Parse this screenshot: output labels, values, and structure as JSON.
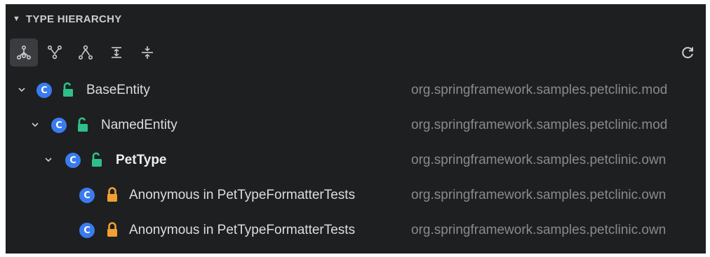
{
  "panel": {
    "title": "TYPE HIERARCHY",
    "collapse_icon": "triangle-down-icon"
  },
  "toolbar": {
    "buttons": [
      {
        "name": "show-type-hierarchy-button",
        "icon": "type-hierarchy-icon",
        "active": true
      },
      {
        "name": "show-supertype-hierarchy-button",
        "icon": "supertype-hierarchy-icon",
        "active": false
      },
      {
        "name": "show-subtype-hierarchy-button",
        "icon": "subtype-hierarchy-icon",
        "active": false
      },
      {
        "name": "expand-all-button",
        "icon": "expand-all-icon",
        "active": false
      },
      {
        "name": "collapse-all-button",
        "icon": "collapse-all-icon",
        "active": false
      }
    ],
    "refresh_icon": "refresh-icon"
  },
  "tree": {
    "rows": [
      {
        "label": "BaseEntity",
        "package": "org.springframework.samples.petclinic.mod",
        "expanded": true,
        "access": "public",
        "bold": false
      },
      {
        "label": "NamedEntity",
        "package": "org.springframework.samples.petclinic.mod",
        "expanded": true,
        "access": "public",
        "bold": false
      },
      {
        "label": "PetType",
        "package": "org.springframework.samples.petclinic.own",
        "expanded": true,
        "access": "public",
        "bold": true
      },
      {
        "label": "Anonymous in PetTypeFormatterTests",
        "package": "org.springframework.samples.petclinic.own",
        "expanded": null,
        "access": "private",
        "bold": false
      },
      {
        "label": "Anonymous in PetTypeFormatterTests",
        "package": "org.springframework.samples.petclinic.own",
        "expanded": null,
        "access": "private",
        "bold": false
      }
    ],
    "class_badge_letter": "C"
  },
  "colors": {
    "background": "#1e1f21",
    "class_badge": "#3a7bf0",
    "public_lock": "#2ec08a",
    "private_lock": "#f0a032",
    "package_text": "#8a8a8a"
  }
}
